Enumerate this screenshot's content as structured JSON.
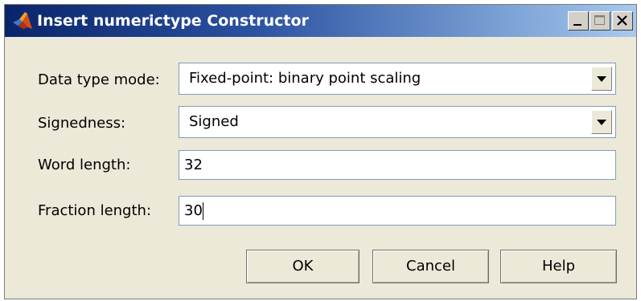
{
  "window": {
    "title": "Insert numerictype Constructor",
    "controls": {
      "minimize": "minimize-icon",
      "maximize": "maximize-icon",
      "close": "close-icon"
    }
  },
  "form": {
    "data_type_mode": {
      "label": "Data type mode:",
      "value": "Fixed-point: binary point scaling"
    },
    "signedness": {
      "label": "Signedness:",
      "value": "Signed"
    },
    "word_length": {
      "label": "Word length:",
      "value": "32"
    },
    "fraction_length": {
      "label": "Fraction length:",
      "value": "30"
    }
  },
  "buttons": {
    "ok": "OK",
    "cancel": "Cancel",
    "help": "Help"
  },
  "colors": {
    "title_bar_start": "#0a246a",
    "title_bar_end": "#a6caf0",
    "dialog_bg": "#ece9d8"
  }
}
